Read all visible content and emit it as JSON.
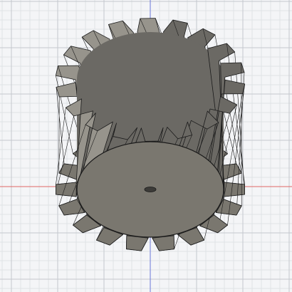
{
  "viewport": {
    "background_color": "#f4f5f7",
    "grid_minor_color": "#dfe2e6",
    "grid_major_color": "#c4c8ce",
    "x_axis_color": "#e06666",
    "y_axis_color": "#6a78d8"
  },
  "model": {
    "name": "helical-gear",
    "tooth_count": 18,
    "body_color": "#6b6964",
    "face_color": "#7a776f",
    "highlight_color": "#97948c",
    "edge_color": "#1a1a1a",
    "bore_icon": "center-hole-icon"
  }
}
